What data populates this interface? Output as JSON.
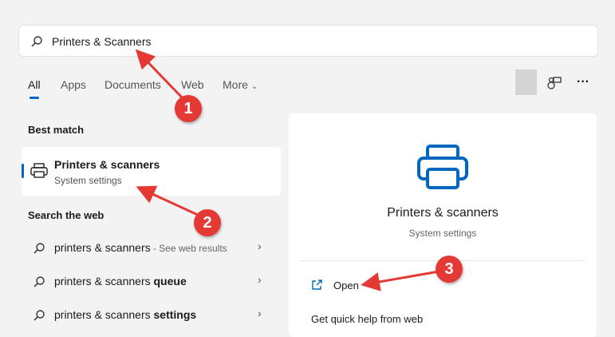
{
  "search": {
    "query": "Printers & Scanners"
  },
  "tabs": [
    "All",
    "Apps",
    "Documents",
    "Web",
    "More"
  ],
  "best_match": {
    "heading": "Best match",
    "title": "Printers & scanners",
    "subtitle": "System settings"
  },
  "web": {
    "heading": "Search the web",
    "items": [
      {
        "prefix": "printers & scanners",
        "bold": "",
        "suffix": " - See web results"
      },
      {
        "prefix": "printers & scanners ",
        "bold": "queue",
        "suffix": ""
      },
      {
        "prefix": "printers & scanners ",
        "bold": "settings",
        "suffix": ""
      }
    ]
  },
  "panel": {
    "title": "Printers & scanners",
    "subtitle": "System settings",
    "open": "Open",
    "help": "Get quick help from web"
  },
  "annotations": [
    "1",
    "2",
    "3"
  ],
  "colors": {
    "accent": "#0067c0",
    "annotation": "#e53935"
  }
}
